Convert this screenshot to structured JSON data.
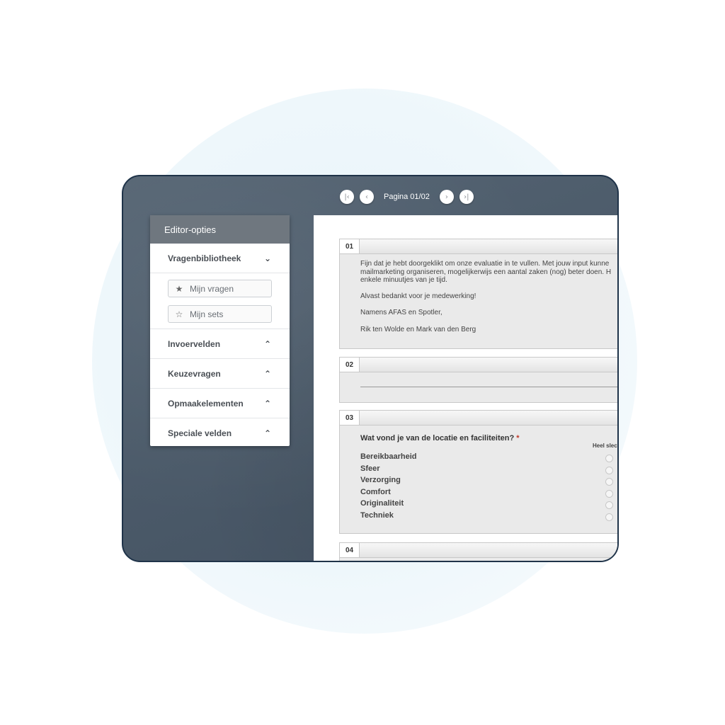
{
  "pager": {
    "first_icon": "first-page-icon",
    "prev_icon": "previous-page-icon",
    "label": "Pagina 01/02",
    "next_icon": "next-page-icon",
    "last_icon": "last-page-icon"
  },
  "sidebar": {
    "title": "Editor-opties",
    "library": {
      "label": "Vragenbibliotheek",
      "chevron": "chevron-down-icon",
      "buttons": [
        {
          "label": "Mijn vragen",
          "icon": "star-filled-icon"
        },
        {
          "label": "Mijn sets",
          "icon": "star-outline-icon"
        }
      ]
    },
    "sections": [
      {
        "label": "Invoervelden",
        "chevron": "chevron-up-icon"
      },
      {
        "label": "Keuzevragen",
        "chevron": "chevron-up-icon"
      },
      {
        "label": "Opmaakelementen",
        "chevron": "chevron-up-icon"
      },
      {
        "label": "Speciale velden",
        "chevron": "chevron-up-icon"
      }
    ]
  },
  "questions": [
    {
      "number": "01",
      "lines": [
        "Fijn dat je hebt doorgeklikt om onze evaluatie in te vullen. Met jouw input kunne",
        "mailmarketing organiseren, mogelijkerwijs een aantal zaken (nog) beter doen. H",
        "enkele minuutjes van je tijd."
      ],
      "thanks": "Alvast bedankt voor je medewerking!",
      "signature_line": "Namens AFAS en Spotler,",
      "names": "Rik ten Wolde en Mark van den Berg"
    },
    {
      "number": "02"
    },
    {
      "number": "03",
      "title": "Wat vond je van de locatie en faciliteiten?",
      "required_mark": "*",
      "scale_label": "Heel slecht",
      "rows": [
        "Bereikbaarheid",
        "Sfeer",
        "Verzorging",
        "Comfort",
        "Originaliteit",
        "Techniek"
      ]
    },
    {
      "number": "04"
    }
  ],
  "colors": {
    "frame_border": "#1f3349",
    "chalkboard": "#4c5b6a",
    "sidebar_header": "#6f777f",
    "required": "#c0392b"
  }
}
